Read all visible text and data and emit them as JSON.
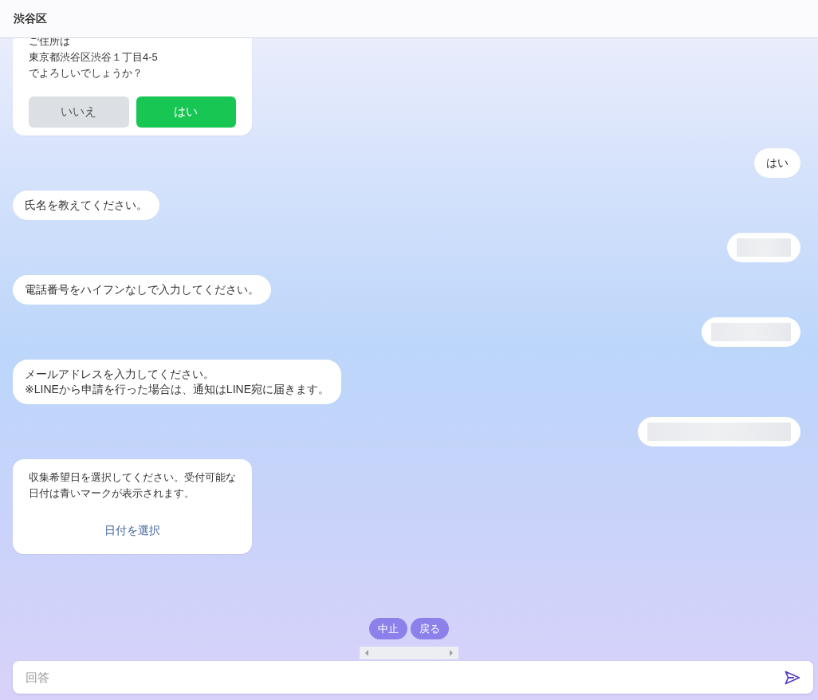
{
  "header": {
    "title": "渋谷区"
  },
  "messages": [
    {
      "kind": "bot_confirm",
      "lines": [
        "ご住所は",
        "東京都渋谷区渋谷１丁目4-5",
        "でよろしいでしょうか？"
      ],
      "buttons": [
        {
          "label": "いいえ",
          "kind": "secondary"
        },
        {
          "label": "はい",
          "kind": "primary"
        }
      ]
    },
    {
      "kind": "user_text",
      "text": "はい"
    },
    {
      "kind": "bot_text",
      "lines": [
        "氏名を教えてください。"
      ]
    },
    {
      "kind": "user_redacted"
    },
    {
      "kind": "bot_text",
      "lines": [
        "電話番号をハイフンなしで入力してください。"
      ]
    },
    {
      "kind": "user_redacted"
    },
    {
      "kind": "bot_text",
      "lines": [
        "メールアドレスを入力してください。",
        "※LINEから申請を行った場合は、通知はLINE宛に届きます。"
      ]
    },
    {
      "kind": "user_redacted"
    },
    {
      "kind": "bot_date_picker",
      "lines": [
        "収集希望日を選択してください。受付可能な",
        "日付は青いマークが表示されます。"
      ],
      "link": "日付を選択"
    }
  ],
  "actions": [
    {
      "label": "中止"
    },
    {
      "label": "戻る"
    }
  ],
  "input": {
    "placeholder": "回答"
  }
}
